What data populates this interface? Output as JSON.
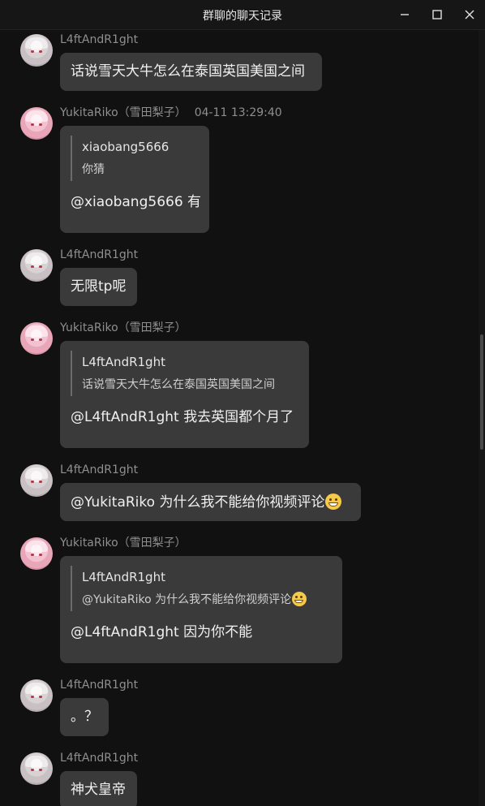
{
  "window": {
    "title": "群聊的聊天记录",
    "controls": {
      "minimize": "minimize-icon",
      "maximize": "maximize-icon",
      "close": "close-icon"
    }
  },
  "messages": [
    {
      "sender": "L4ftAndR1ght",
      "text": "话说雪天大牛怎么在泰国英国美国之间"
    },
    {
      "sender": "YukitaRiko（雪田梨子）",
      "time": "04-11 13:29:40",
      "quote": {
        "name": "xiaobang5666",
        "text": "你猜"
      },
      "text": "@xiaobang5666 有"
    },
    {
      "sender": "L4ftAndR1ght",
      "text": "无限tp呢"
    },
    {
      "sender": "YukitaRiko（雪田梨子）",
      "quote": {
        "name": "L4ftAndR1ght",
        "text": "话说雪天大牛怎么在泰国英国美国之间"
      },
      "text": "@L4ftAndR1ght 我去英国都个月了"
    },
    {
      "sender": "L4ftAndR1ght",
      "text": "@YukitaRiko 为什么我不能给你视频评论"
    },
    {
      "sender": "YukitaRiko（雪田梨子）",
      "quote": {
        "name": "L4ftAndR1ght",
        "text": "@YukitaRiko 为什么我不能给你视频评论"
      },
      "text": "@L4ftAndR1ght 因为你不能"
    },
    {
      "sender": "L4ftAndR1ght",
      "text": "。？"
    },
    {
      "sender": "L4ftAndR1ght",
      "text": "神犬皇帝"
    }
  ],
  "emoji": {
    "grin": "grinning-face-emoji"
  },
  "colors": {
    "background": "#111111",
    "bubble": "#3a3a3a",
    "sender": "#8f8f8f",
    "text": "#f0f0f0"
  }
}
